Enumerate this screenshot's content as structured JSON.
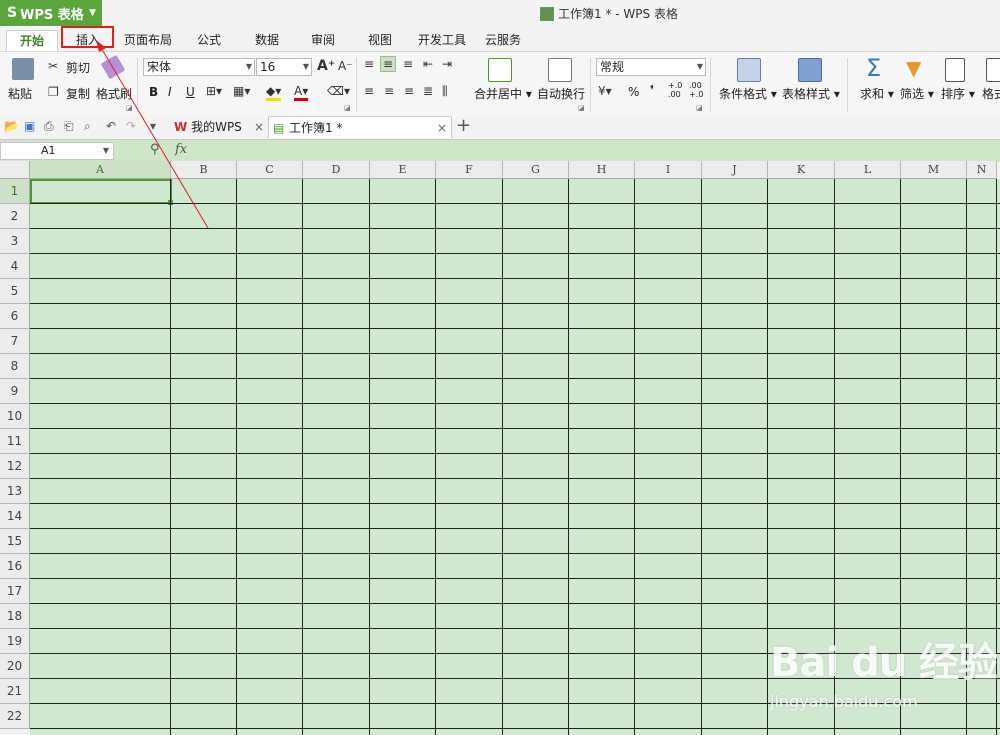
{
  "app": {
    "name": "WPS 表格",
    "window_title": "工作簿1 * - WPS 表格"
  },
  "tabs": [
    "开始",
    "插入",
    "页面布局",
    "公式",
    "数据",
    "审阅",
    "视图",
    "开发工具",
    "云服务"
  ],
  "ribbon": {
    "paste": "粘贴",
    "cut": "剪切",
    "copy": "复制",
    "format_painter": "格式刷",
    "font_name": "宋体",
    "font_size": "16",
    "bold": "B",
    "italic": "I",
    "underline": "U",
    "merge_center": "合并居中",
    "wrap_text": "自动换行",
    "number_format": "常规",
    "percent": "%",
    "comma": "❜",
    "inc_decimal_top": "+.0",
    "inc_decimal_bottom": ".00",
    "dec_decimal_top": ".00",
    "dec_decimal_bottom": "+.0",
    "cond_format": "条件格式",
    "table_style": "表格样式",
    "sum": "求和",
    "filter": "筛选",
    "sort": "排序",
    "format": "格式"
  },
  "doc_tabs": {
    "home": "我的WPS",
    "book": "工作簿1 *",
    "add": "+"
  },
  "formula_bar": {
    "name_box": "A1",
    "fx": "fx"
  },
  "grid": {
    "columns": [
      "A",
      "B",
      "C",
      "D",
      "E",
      "F",
      "G",
      "H",
      "I",
      "J",
      "K",
      "L",
      "M",
      "N"
    ],
    "rows": [
      "1",
      "2",
      "3",
      "4",
      "5",
      "6",
      "7",
      "8",
      "9",
      "10",
      "11",
      "12",
      "13",
      "14",
      "15",
      "16",
      "17",
      "18",
      "19",
      "20",
      "21",
      "22"
    ]
  },
  "watermark": {
    "main": "Bai du 经验",
    "sub": "jingyan.baidu.com"
  },
  "colors": {
    "accent": "#5aa53c",
    "grid_fill": "#cfe8cf",
    "highlight": "#e02020"
  }
}
